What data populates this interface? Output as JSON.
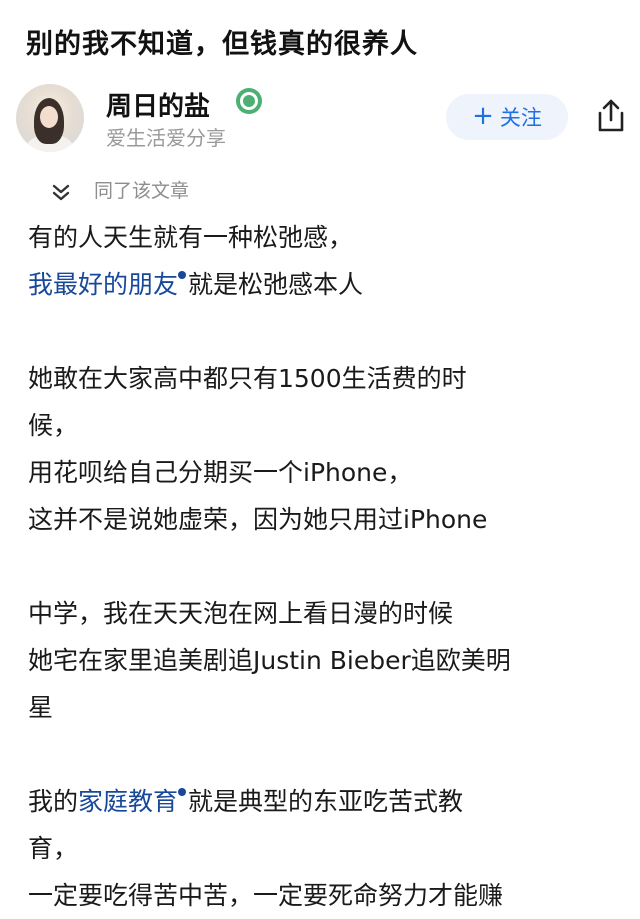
{
  "question_title": "别的我不知道，但钱真的很养人",
  "author": {
    "name": "周日的盐",
    "badge_icon": "verified-badge-icon",
    "description": "爱生活爱分享",
    "follow_label": "关注",
    "follow_color": "#1f6fe5"
  },
  "agree_text": "同了该文章",
  "content": {
    "p1_line1": "有的人天生就有一种松弛感，",
    "p1_link": "我最好的朋友",
    "p1_line2_rest": "就是松弛感本人",
    "p2_line1": "她敢在大家高中都只有1500生活费的时",
    "p2_line2": "候，",
    "p2_line3": "用花呗给自己分期买一个iPhone，",
    "p2_line4": "这并不是说她虚荣，因为她只用过iPhone",
    "p3_line1": "中学，我在天天泡在网上看日漫的时候",
    "p3_line2": "她宅在家里追美剧追Justin Bieber追欧美明",
    "p3_line3": "星",
    "p4_prefix": "我的",
    "p4_link": "家庭教育",
    "p4_rest": "就是典型的东亚吃苦式教",
    "p4_line2": "育，",
    "p4_line3": "一定要吃得苦中苦，一定要死命努力才能赚"
  },
  "colors": {
    "link": "#17489a",
    "text": "#1a1a1a",
    "secondary": "#9a9a9a"
  }
}
